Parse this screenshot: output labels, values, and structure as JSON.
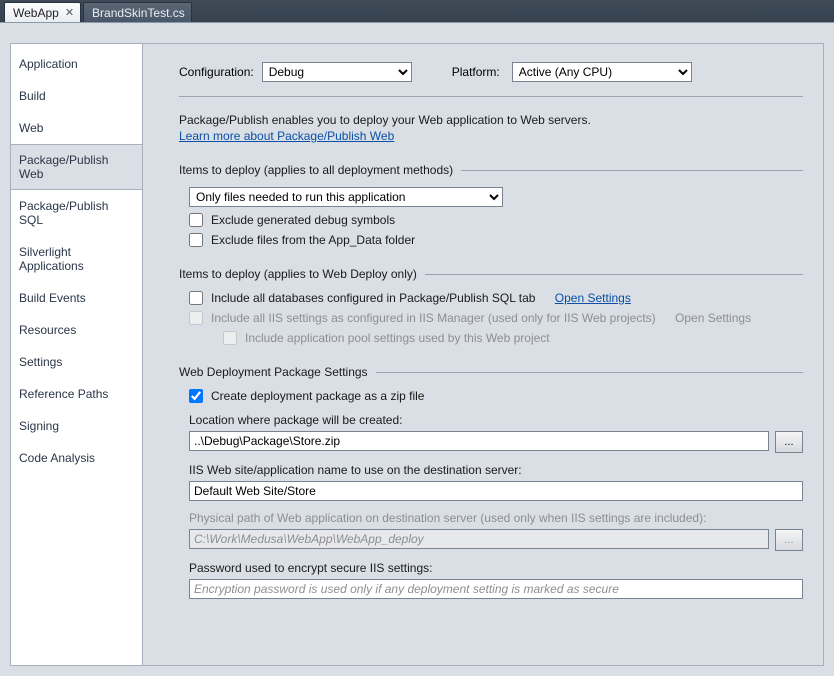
{
  "tabs": {
    "active": "WebApp",
    "inactive": "BrandSkinTest.cs"
  },
  "sidebar": {
    "items": [
      {
        "label": "Application"
      },
      {
        "label": "Build"
      },
      {
        "label": "Web"
      },
      {
        "label": "Package/Publish Web",
        "selected": true
      },
      {
        "label": "Package/Publish SQL"
      },
      {
        "label": "Silverlight Applications"
      },
      {
        "label": "Build Events"
      },
      {
        "label": "Resources"
      },
      {
        "label": "Settings"
      },
      {
        "label": "Reference Paths"
      },
      {
        "label": "Signing"
      },
      {
        "label": "Code Analysis"
      }
    ]
  },
  "header": {
    "configuration_label": "Configuration:",
    "configuration_value": "Debug",
    "platform_label": "Platform:",
    "platform_value": "Active (Any CPU)"
  },
  "intro": {
    "line1": "Package/Publish enables you to deploy your Web application to Web servers.",
    "link": "Learn more about Package/Publish Web"
  },
  "section1": {
    "title": "Items to deploy (applies to all deployment methods)",
    "items_select": "Only files needed to run this application",
    "cb_exclude_debug": "Exclude generated debug symbols",
    "cb_exclude_appdata": "Exclude files from the App_Data folder"
  },
  "section2": {
    "title": "Items to deploy (applies to Web Deploy only)",
    "cb_include_db": "Include all databases configured in Package/Publish SQL tab",
    "open_settings": "Open Settings",
    "cb_include_iis": "Include all IIS settings as configured in IIS Manager (used only for IIS Web projects)",
    "open_settings2": "Open Settings",
    "cb_include_apppool": "Include application pool settings used by this Web project"
  },
  "section3": {
    "title": "Web Deployment Package Settings",
    "cb_zip": "Create deployment package as a zip file",
    "loc_label": "Location where package will be created:",
    "loc_value": "..\\Debug\\Package\\Store.zip",
    "site_label": "IIS Web site/application name to use on the destination server:",
    "site_value": "Default Web Site/Store",
    "phys_label": "Physical path of Web application on destination server (used only when IIS settings are included):",
    "phys_value": "C:\\Work\\Medusa\\WebApp\\WebApp_deploy",
    "pwd_label": "Password used to encrypt secure IIS settings:",
    "pwd_placeholder": "Encryption password is used only if any deployment setting is marked as secure",
    "browse": "..."
  }
}
